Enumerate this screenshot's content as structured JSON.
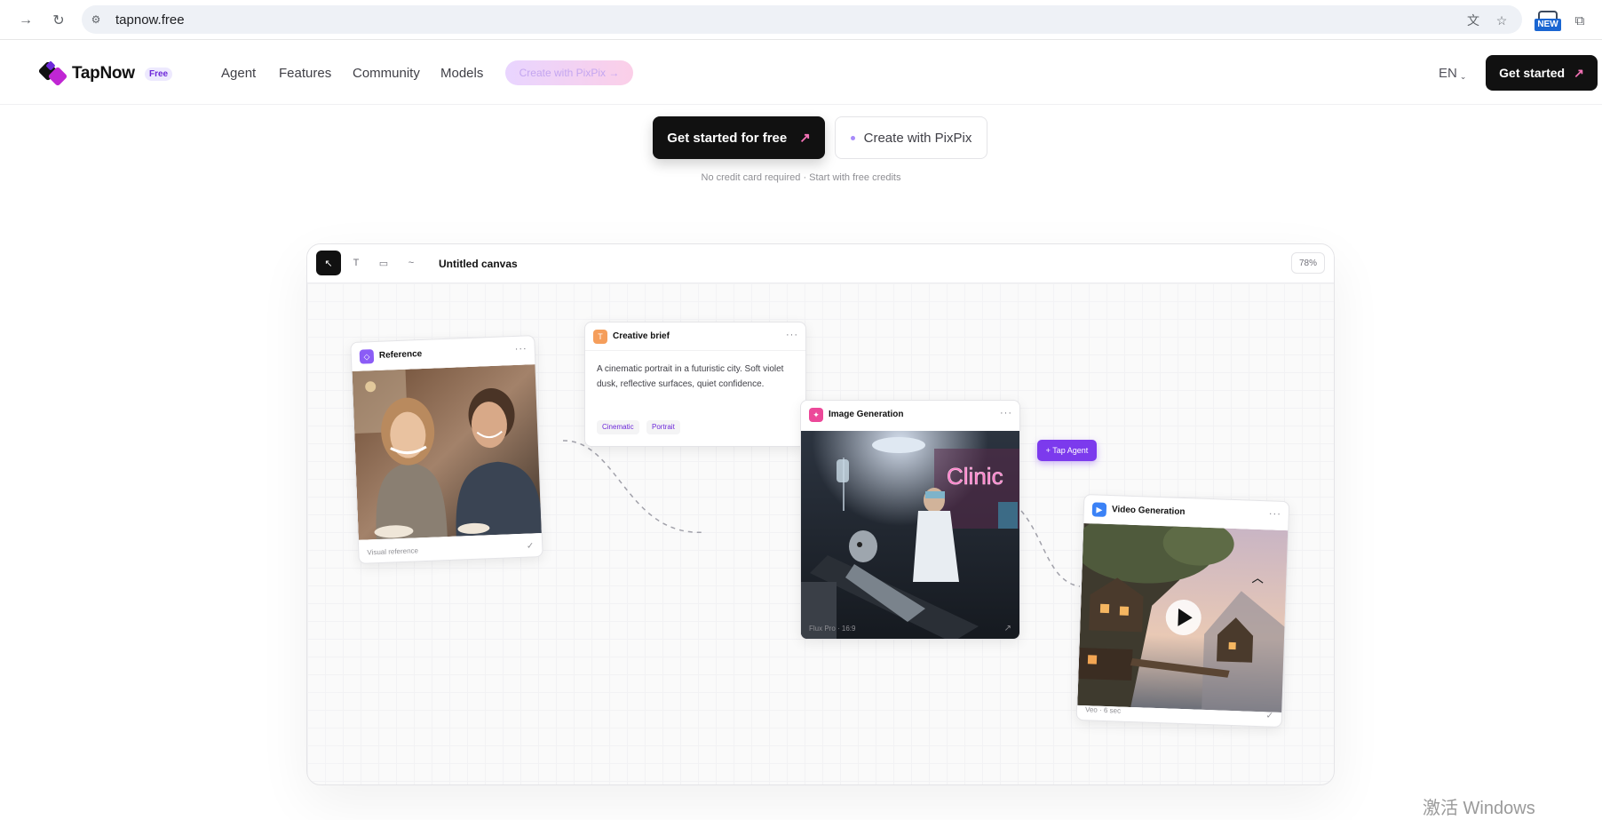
{
  "browser": {
    "url": "tapnow.free",
    "new_badge": "NEW"
  },
  "header": {
    "brand": "TapNow",
    "badge": "Free",
    "nav": [
      "Agent",
      "Features",
      "Community",
      "Models"
    ],
    "pixpix_pill": "Create with PixPix →",
    "language": "EN",
    "cta": "Get started"
  },
  "hero": {
    "primary_cta": "Get started for free",
    "secondary_cta": "Create with PixPix",
    "note": "No credit card required · Start with free credits"
  },
  "canvas": {
    "title": "Untitled canvas",
    "zoom": "78%",
    "tools": [
      "↖",
      "T",
      "▭",
      "~"
    ],
    "reference": {
      "title": "Reference",
      "footer": "Visual reference",
      "accent": "#8b5cf6"
    },
    "brief": {
      "title": "Creative brief",
      "icon_letter": "T",
      "body": "A cinematic portrait in a futuristic city. Soft violet dusk, reflective surfaces, quiet confidence.",
      "tags": [
        "Cinematic",
        "Portrait"
      ],
      "accent": "#f59e5b"
    },
    "image_gen": {
      "title": "Image Generation",
      "footer": "Flux Pro · 16:9",
      "sign": "Clinic",
      "accent": "#ec4899"
    },
    "video_gen": {
      "title": "Video Generation",
      "footer": "Veo · 6 sec",
      "accent": "#3b82f6"
    },
    "agent_pill": "+ Tap Agent"
  },
  "watermark": "激活 Windows"
}
